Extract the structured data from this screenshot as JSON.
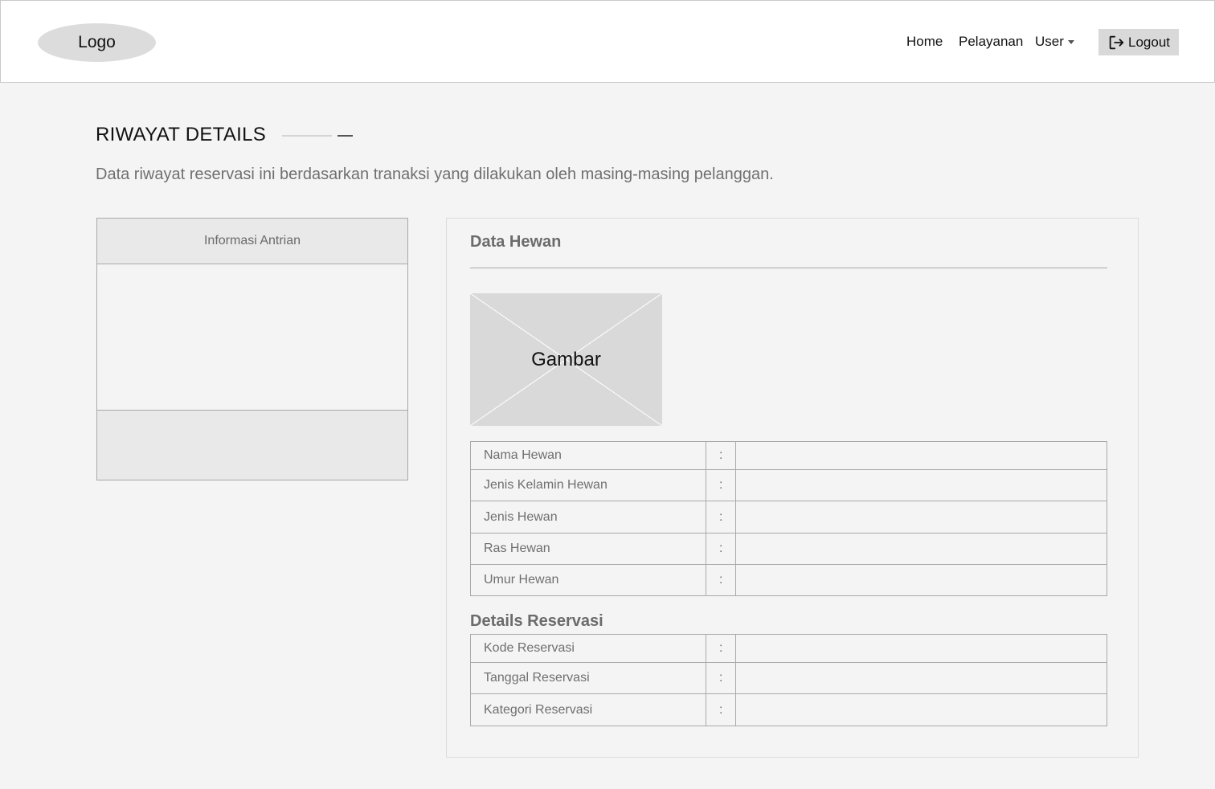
{
  "nav": {
    "logo": "Logo",
    "links": {
      "home": "Home",
      "pelayanan": "Pelayanan",
      "user": "User"
    },
    "logout": "Logout"
  },
  "page": {
    "title": "RIWAYAT DETAILS",
    "description": "Data riwayat reservasi ini berdasarkan tranaksi yang dilakukan oleh masing-masing pelanggan."
  },
  "left_card": {
    "header": "Informasi Antrian"
  },
  "right_card": {
    "data_hewan_title": "Data Hewan",
    "image_label": "Gambar",
    "hewan_rows": [
      {
        "label": "Nama Hewan",
        "sep": ":",
        "value": ""
      },
      {
        "label": "Jenis Kelamin Hewan",
        "sep": ":",
        "value": ""
      },
      {
        "label": "Jenis Hewan",
        "sep": ":",
        "value": ""
      },
      {
        "label": "Ras Hewan",
        "sep": ":",
        "value": ""
      },
      {
        "label": "Umur Hewan",
        "sep": ":",
        "value": ""
      }
    ],
    "reservasi_title": "Details Reservasi",
    "reservasi_rows": [
      {
        "label": "Kode Reservasi",
        "sep": ":",
        "value": ""
      },
      {
        "label": "Tanggal Reservasi",
        "sep": ":",
        "value": ""
      },
      {
        "label": "Kategori Reservasi",
        "sep": ":",
        "value": ""
      }
    ]
  },
  "icons": {
    "logout": "logout-icon",
    "dropdown": "caret-down-icon"
  }
}
